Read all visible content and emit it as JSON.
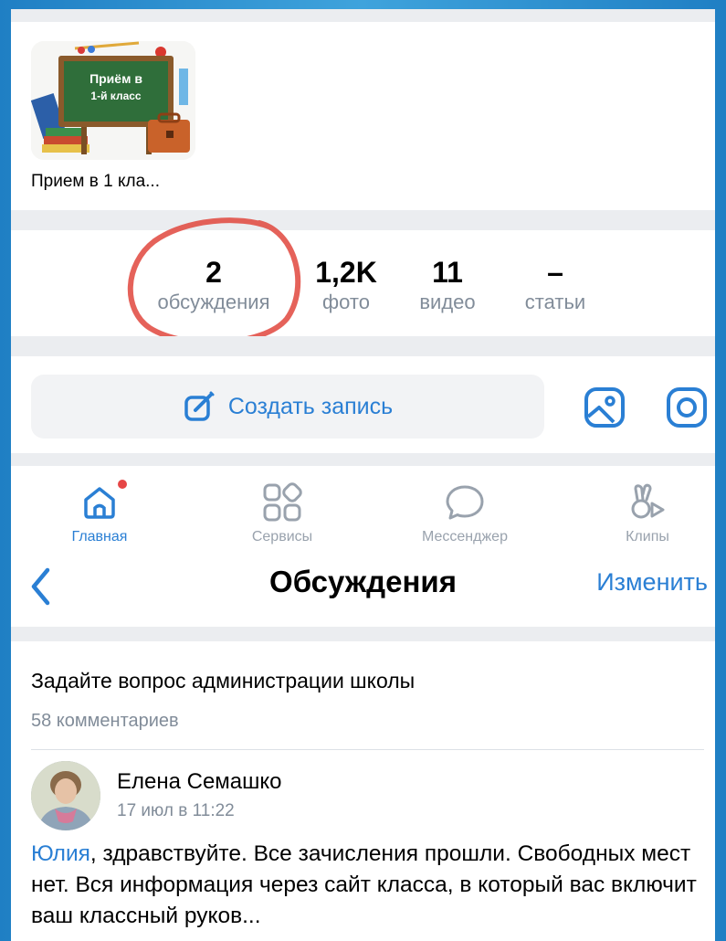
{
  "album": {
    "thumb_line1": "Приём в",
    "thumb_line2": "1-й класс",
    "title": "Прием в 1 кла..."
  },
  "counters": [
    {
      "value": "2",
      "label": "обсуждения"
    },
    {
      "value": "1,2K",
      "label": "фото"
    },
    {
      "value": "11",
      "label": "видео"
    },
    {
      "value": "–",
      "label": "статьи"
    }
  ],
  "actions": {
    "create_post_label": "Создать запись"
  },
  "tabbar": [
    {
      "label": "Главная",
      "icon": "home-icon"
    },
    {
      "label": "Сервисы",
      "icon": "services-icon"
    },
    {
      "label": "Мессенджер",
      "icon": "messenger-icon"
    },
    {
      "label": "Клипы",
      "icon": "clips-icon"
    }
  ],
  "header": {
    "title": "Обсуждения",
    "edit_label": "Изменить"
  },
  "topic": {
    "title": "Задайте вопрос администрации школы",
    "comments": "58 комментариев"
  },
  "last_comment": {
    "author": "Елена Семашко",
    "date": "17 июл в 11:22",
    "mention": "Юлия",
    "text": ", здравствуйте. Все зачисления прошли. Свободных мест нет. Вся информация через сайт класса, в который вас включит ваш классный руков..."
  },
  "colors": {
    "accent": "#2a7fd4",
    "secondary_text": "#818c99",
    "highlight_circle": "#e0463d",
    "notification_dot": "#e64646"
  }
}
